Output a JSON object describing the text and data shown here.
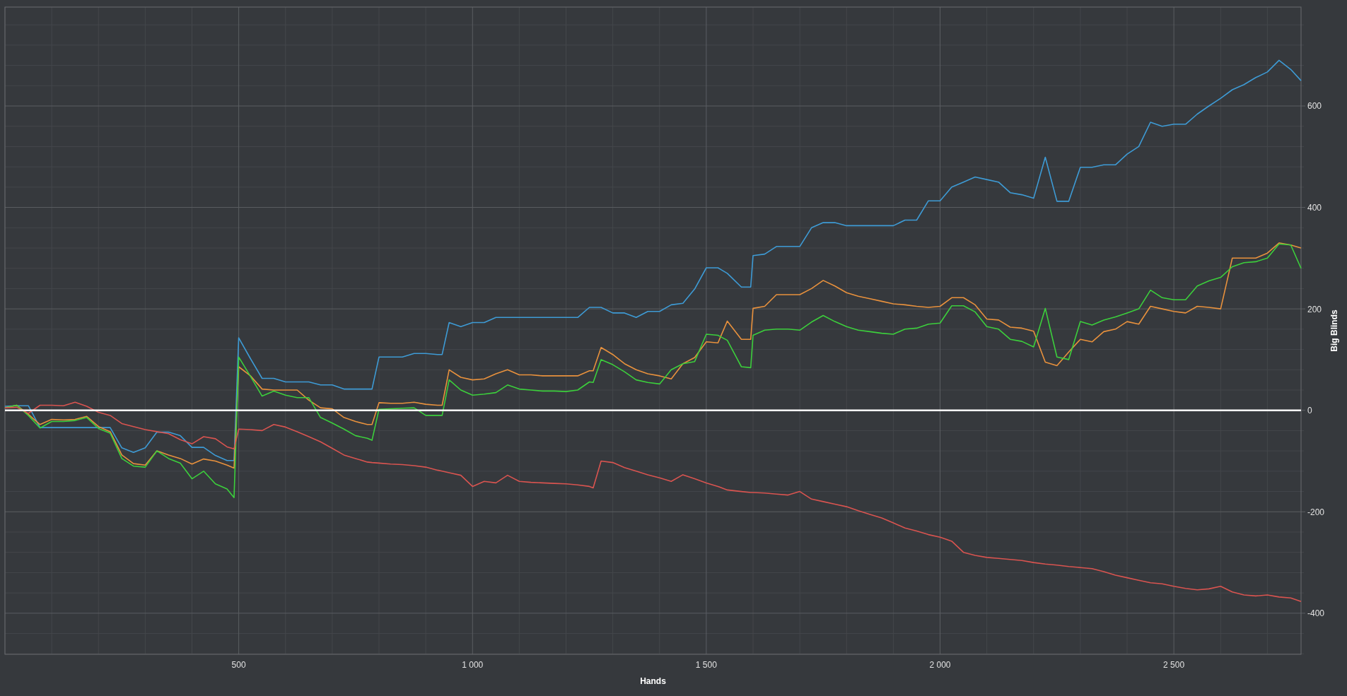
{
  "chart": {
    "chart_data": {
      "type": "line",
      "xlabel": "Hands",
      "ylabel": "Big Blinds",
      "grid": true,
      "x": [
        0,
        25,
        50,
        75,
        100,
        125,
        150,
        175,
        200,
        225,
        250,
        275,
        300,
        325,
        350,
        375,
        400,
        425,
        450,
        475,
        490,
        500,
        525,
        550,
        575,
        600,
        625,
        650,
        675,
        700,
        725,
        750,
        775,
        785,
        800,
        825,
        850,
        875,
        900,
        925,
        935,
        950,
        975,
        1000,
        1025,
        1050,
        1075,
        1100,
        1125,
        1150,
        1175,
        1200,
        1225,
        1250,
        1258,
        1275,
        1300,
        1325,
        1350,
        1375,
        1400,
        1425,
        1450,
        1475,
        1500,
        1525,
        1545,
        1575,
        1595,
        1600,
        1625,
        1650,
        1675,
        1700,
        1725,
        1750,
        1775,
        1800,
        1825,
        1850,
        1875,
        1900,
        1925,
        1950,
        1975,
        2000,
        2025,
        2050,
        2075,
        2100,
        2125,
        2150,
        2175,
        2200,
        2225,
        2250,
        2275,
        2300,
        2325,
        2350,
        2375,
        2400,
        2425,
        2450,
        2475,
        2500,
        2525,
        2550,
        2575,
        2600,
        2625,
        2650,
        2675,
        2700,
        2725,
        2750,
        2772
      ],
      "series": [
        {
          "color": "#3e9bd5",
          "values": [
            8,
            9,
            9,
            -34,
            -34,
            -34,
            -34,
            -34,
            -34,
            -34,
            -74,
            -83,
            -74,
            -43,
            -43,
            -50,
            -73,
            -73,
            -89,
            -99,
            -99,
            143,
            102,
            63,
            63,
            56,
            56,
            56,
            50,
            50,
            42,
            42,
            42,
            42,
            105,
            105,
            105,
            112,
            112,
            110,
            110,
            173,
            165,
            173,
            173,
            183,
            183,
            183,
            183,
            183,
            183,
            183,
            183,
            203,
            203,
            203,
            192,
            192,
            183,
            195,
            195,
            208,
            211,
            239,
            281,
            281,
            270,
            243,
            243,
            305,
            308,
            323,
            323,
            323,
            360,
            370,
            370,
            364,
            364,
            364,
            364,
            364,
            375,
            375,
            413,
            413,
            440,
            450,
            460,
            455,
            450,
            429,
            425,
            418,
            499,
            412,
            412,
            479,
            479,
            484,
            484,
            505,
            520,
            568,
            560,
            564,
            564,
            584,
            600,
            615,
            632,
            642,
            656,
            667,
            690,
            672,
            650
          ]
        },
        {
          "color": "#e8913d",
          "values": [
            5,
            10,
            -8,
            -28,
            -18,
            -19,
            -18,
            -12,
            -32,
            -42,
            -88,
            -105,
            -108,
            -80,
            -88,
            -95,
            -106,
            -96,
            -100,
            -108,
            -114,
            86,
            68,
            42,
            40,
            40,
            40,
            20,
            5,
            3,
            -14,
            -22,
            -28,
            -28,
            15,
            14,
            14,
            16,
            12,
            10,
            10,
            80,
            65,
            60,
            62,
            72,
            80,
            70,
            70,
            68,
            68,
            68,
            68,
            78,
            78,
            124,
            110,
            92,
            80,
            72,
            68,
            62,
            92,
            104,
            135,
            133,
            176,
            140,
            140,
            201,
            205,
            228,
            228,
            228,
            240,
            256,
            245,
            232,
            225,
            220,
            215,
            210,
            208,
            205,
            203,
            205,
            222,
            222,
            208,
            180,
            178,
            164,
            162,
            156,
            95,
            88,
            115,
            140,
            135,
            155,
            160,
            175,
            170,
            205,
            200,
            195,
            192,
            205,
            203,
            200,
            300,
            300,
            300,
            310,
            330,
            326,
            320
          ]
        },
        {
          "color": "#3ccf3c",
          "values": [
            5,
            10,
            -10,
            -35,
            -22,
            -22,
            -20,
            -14,
            -36,
            -45,
            -95,
            -110,
            -112,
            -80,
            -95,
            -104,
            -135,
            -120,
            -145,
            -155,
            -172,
            105,
            67,
            28,
            38,
            30,
            25,
            25,
            -14,
            -25,
            -37,
            -50,
            -55,
            -59,
            2,
            3,
            4,
            5,
            -10,
            -10,
            -10,
            60,
            40,
            30,
            32,
            35,
            50,
            42,
            40,
            38,
            38,
            37,
            40,
            56,
            55,
            100,
            90,
            76,
            60,
            55,
            52,
            80,
            92,
            96,
            150,
            148,
            138,
            86,
            84,
            148,
            158,
            160,
            160,
            158,
            174,
            187,
            175,
            165,
            158,
            155,
            152,
            150,
            160,
            162,
            170,
            172,
            206,
            206,
            194,
            165,
            160,
            140,
            136,
            125,
            201,
            105,
            100,
            175,
            168,
            178,
            184,
            192,
            200,
            237,
            222,
            218,
            218,
            245,
            255,
            262,
            283,
            291,
            293,
            300,
            328,
            326,
            280
          ]
        },
        {
          "color": "#d95450",
          "values": [
            5,
            6,
            -6,
            10,
            10,
            9,
            16,
            8,
            -4,
            -10,
            -26,
            -32,
            -38,
            -42,
            -46,
            -58,
            -66,
            -52,
            -56,
            -72,
            -76,
            -37,
            -38,
            -40,
            -28,
            -33,
            -42,
            -52,
            -62,
            -75,
            -88,
            -95,
            -102,
            -103,
            -104,
            -106,
            -107,
            -109,
            -112,
            -118,
            -120,
            -123,
            -128,
            -150,
            -140,
            -143,
            -128,
            -140,
            -142,
            -143,
            -144,
            -145,
            -147,
            -150,
            -153,
            -100,
            -103,
            -113,
            -120,
            -127,
            -133,
            -140,
            -127,
            -135,
            -143,
            -150,
            -157,
            -160,
            -162,
            -162,
            -163,
            -165,
            -167,
            -160,
            -175,
            -180,
            -185,
            -190,
            -198,
            -205,
            -212,
            -222,
            -232,
            -238,
            -245,
            -250,
            -258,
            -280,
            -286,
            -290,
            -292,
            -294,
            -296,
            -300,
            -303,
            -305,
            -308,
            -310,
            -312,
            -318,
            -325,
            -330,
            -335,
            -340,
            -342,
            -347,
            -351,
            -354,
            -352,
            -347,
            -358,
            -364,
            -366,
            -364,
            -368,
            -370,
            -377
          ]
        }
      ],
      "xlim": [
        0,
        2772
      ],
      "ylim": [
        -481,
        795
      ],
      "xticks": [
        500,
        {
          "value": 1000,
          "label": "1 000"
        },
        {
          "value": 1500,
          "label": "1 500"
        },
        {
          "value": 2000,
          "label": "2 000"
        },
        {
          "value": 2500,
          "label": "2 500"
        }
      ],
      "yticks": [
        -400,
        -200,
        0,
        200,
        400,
        600
      ],
      "ref_lines": [
        {
          "axis": "y",
          "value": 0,
          "color": "#ffffff"
        }
      ]
    }
  }
}
